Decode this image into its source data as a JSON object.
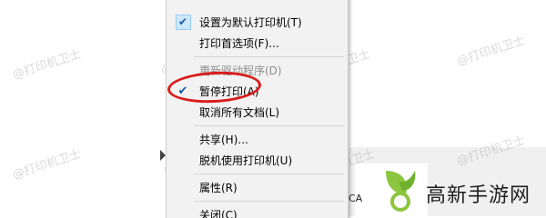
{
  "menu": {
    "items": [
      {
        "label": "设置为默认打印机(T)",
        "checked": true,
        "disabled": false
      },
      {
        "label": "打印首选项(F)...",
        "checked": false,
        "disabled": false
      },
      {
        "label": "更新驱动程序(D)",
        "checked": false,
        "disabled": true
      },
      {
        "label": "暂停打印(A)",
        "checked": true,
        "disabled": false
      },
      {
        "label": "取消所有文档(L)",
        "checked": false,
        "disabled": false
      },
      {
        "label": "共享(H)...",
        "checked": false,
        "disabled": false
      },
      {
        "label": "脱机使用打印机(U)",
        "checked": false,
        "disabled": false
      },
      {
        "label": "属性(R)",
        "checked": false,
        "disabled": false
      },
      {
        "label": "关闭(C)",
        "checked": false,
        "disabled": false
      }
    ],
    "check_glyph": "✔"
  },
  "watermark": "@打印机卫士",
  "background": {
    "partial_text": "CA"
  },
  "logo": {
    "text": "高新手游网",
    "icon": "leaf-logo-icon",
    "colors": {
      "green": "#8cc63f",
      "dark": "#1e1e1e"
    }
  },
  "annotation": {
    "color": "#d91c1c",
    "target": "暂停打印(A)"
  }
}
